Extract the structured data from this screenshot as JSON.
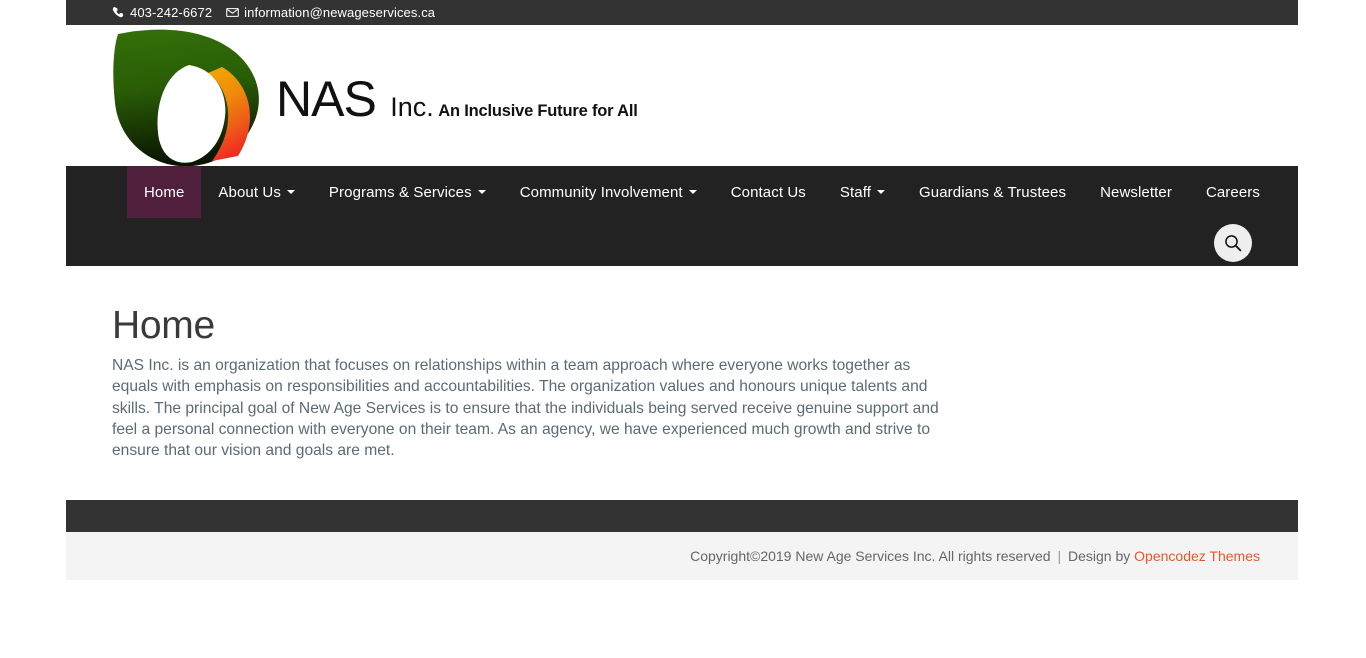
{
  "topbar": {
    "phone": "403-242-6672",
    "email": "information@newageservices.ca",
    "phone_icon": "phone-icon",
    "email_icon": "envelope-icon",
    "background": "#333333"
  },
  "logo": {
    "name": "NAS",
    "suffix": "Inc.",
    "tagline": "An Inclusive Future for All",
    "mark_colors": {
      "green_top": "#2d6606",
      "green_bottom": "#0d1a03",
      "orange_top": "#f0a000",
      "orange_bottom": "#ee3524"
    }
  },
  "nav": {
    "background": "#222222",
    "active_background": "#4f1f3b",
    "items": [
      {
        "label": "Home",
        "active": true,
        "caret": false
      },
      {
        "label": "About Us",
        "active": false,
        "caret": true
      },
      {
        "label": "Programs & Services",
        "active": false,
        "caret": true
      },
      {
        "label": "Community Involvement",
        "active": false,
        "caret": true
      },
      {
        "label": "Contact Us",
        "active": false,
        "caret": false
      },
      {
        "label": "Staff",
        "active": false,
        "caret": true
      },
      {
        "label": "Guardians & Trustees",
        "active": false,
        "caret": false
      },
      {
        "label": "Newsletter",
        "active": false,
        "caret": false
      },
      {
        "label": "Careers",
        "active": false,
        "caret": false
      }
    ],
    "search_icon": "search-icon"
  },
  "main": {
    "title": "Home",
    "paragraph": "NAS Inc. is an organization that focuses on relationships within a team approach where everyone works together as equals with emphasis on responsibilities and accountabilities. The organization values and honours unique talents and skills. The principal goal of New Age Services is to ensure that the individuals being served receive genuine support and feel a personal connection with everyone on their team. As an agency, we have experienced much growth and strive to ensure that our vision and goals are met."
  },
  "footer": {
    "copyright": "Copyright©2019 New Age Services Inc. All rights reserved",
    "separator": "|",
    "design_by": "Design by",
    "credit": "Opencodez Themes",
    "credit_color": "#e8572a",
    "dark_background": "#333333",
    "light_background": "#f4f4f4"
  }
}
